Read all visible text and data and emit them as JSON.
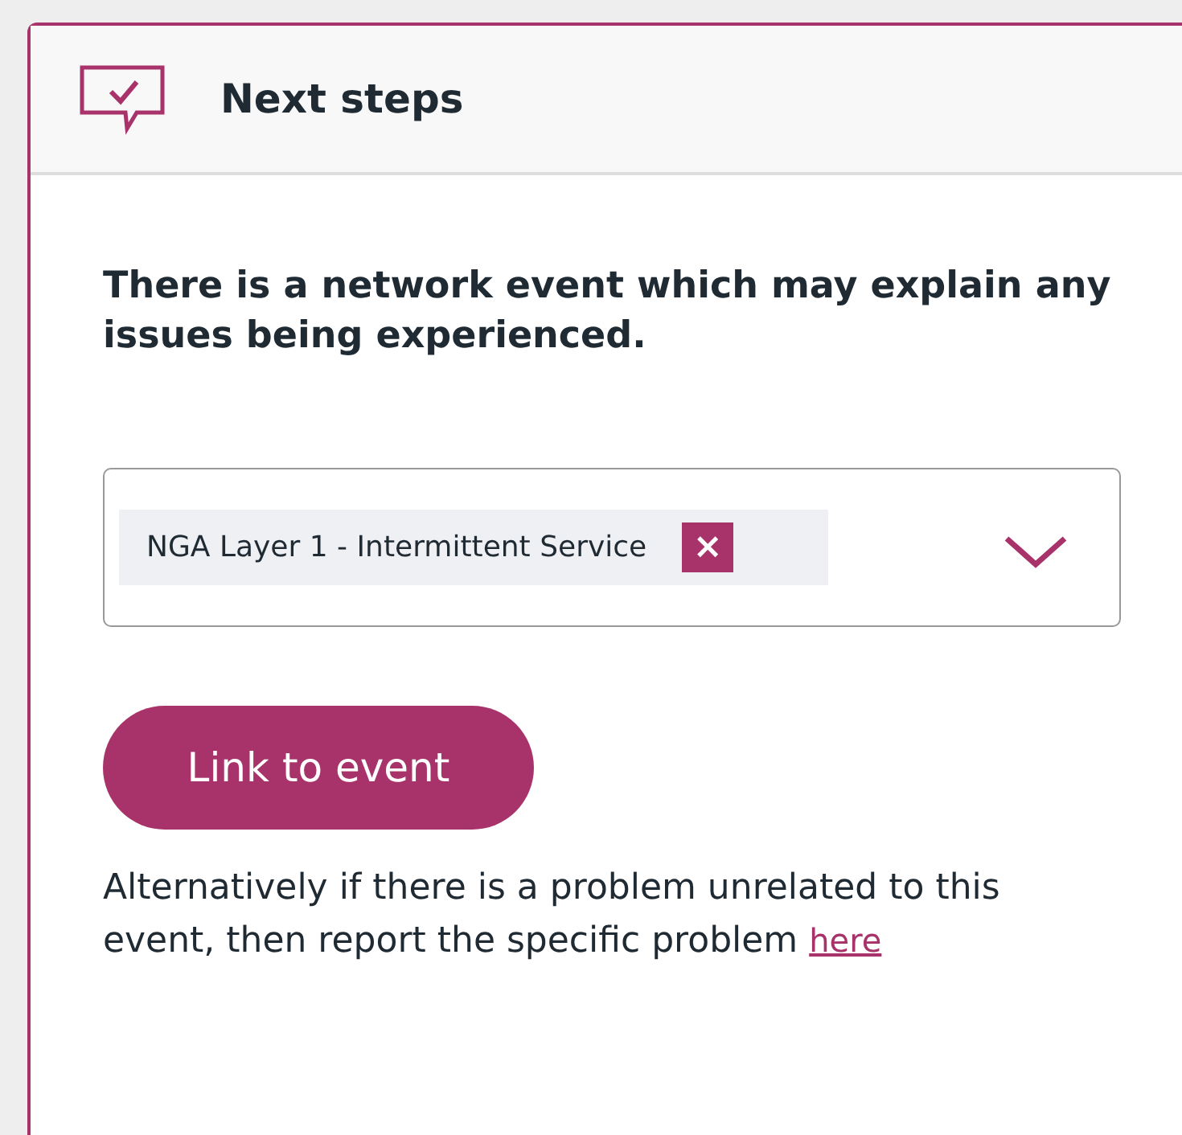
{
  "panel": {
    "title": "Next steps"
  },
  "message": "There is a network event which may explain any issues being experienced.",
  "dropdown": {
    "selected_items": [
      {
        "label": "NGA Layer 1 - Intermittent Service",
        "remove": "×"
      }
    ]
  },
  "button": "Link to event",
  "note": {
    "text": "Alternatively if there is a problem unrelated to this event, then report the specific problem",
    "link": "here"
  }
}
